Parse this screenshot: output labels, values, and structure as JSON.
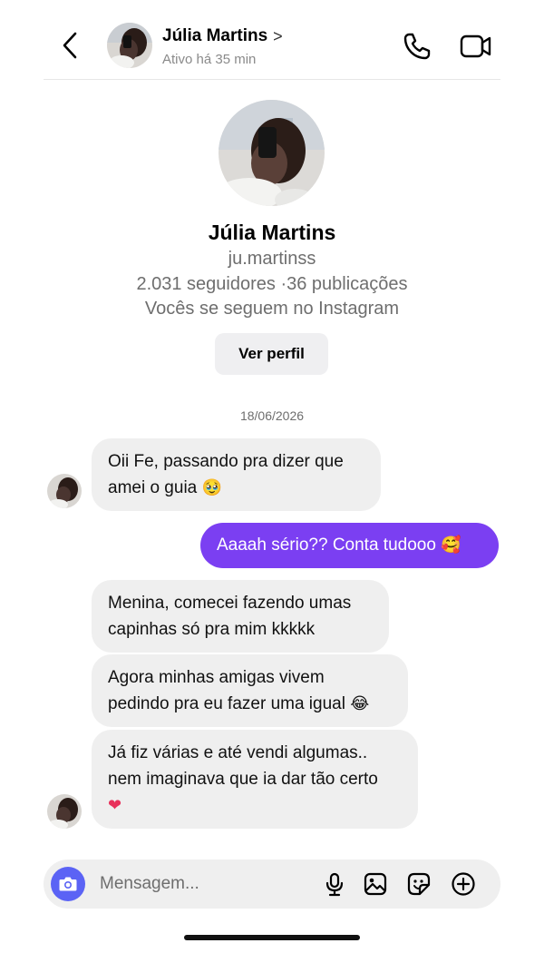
{
  "header": {
    "name": "Júlia Martins",
    "chevron": ">",
    "status": "Ativo há 35 min"
  },
  "profile": {
    "name": "Júlia Martins",
    "handle": "ju.martinss",
    "stats": "2.031 seguidores ·36 publicações",
    "follow_status": "Vocês se seguem no Instagram",
    "view_profile_label": "Ver perfil"
  },
  "date_separator": "18/06/2026",
  "messages": [
    {
      "side": "incoming",
      "lines": [
        "Oii Fe, passando pra dizer que",
        "amei o guia"
      ],
      "emoji": "🥹"
    },
    {
      "side": "outgoing",
      "lines": [
        "Aaaah sério?? Conta tudooo"
      ],
      "emoji": "🥰"
    },
    {
      "side": "incoming",
      "lines": [
        "Menina, comecei fazendo umas",
        "capinhas só pra mim kkkkk"
      ],
      "emoji": ""
    },
    {
      "side": "incoming",
      "lines": [
        "Agora minhas amigas vivem",
        "pedindo pra eu fazer uma igual"
      ],
      "emoji": "😂"
    },
    {
      "side": "incoming",
      "lines": [
        "Já fiz várias e até vendi algumas..",
        "nem imaginava que ia dar tão certo"
      ],
      "emoji": "❤"
    }
  ],
  "composer": {
    "placeholder": "Mensagem..."
  },
  "colors": {
    "outgoing_bubble": "#7b3ff2",
    "incoming_bubble": "#efefef",
    "camera_button": "#5b63f5"
  },
  "icons": [
    "back-chevron-icon",
    "phone-icon",
    "video-camera-icon",
    "camera-icon",
    "microphone-icon",
    "image-icon",
    "sticker-icon",
    "plus-circle-icon"
  ]
}
